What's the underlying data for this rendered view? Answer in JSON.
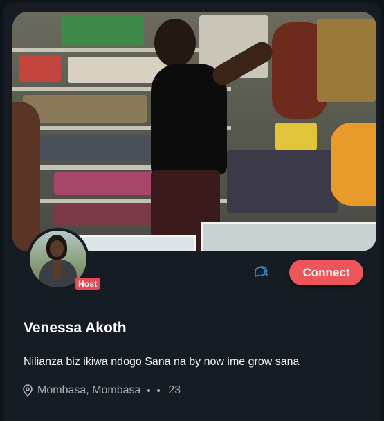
{
  "profile": {
    "name": "Venessa Akoth",
    "badge": "Host",
    "bio": "Nilianza biz ikiwa ndogo Sana na by now ime grow sana",
    "location": "Mombasa, Mombasa",
    "count": "23"
  },
  "actions": {
    "connect_label": "Connect",
    "chat_icon": "chat-bubbles-icon"
  },
  "colors": {
    "accent": "#ec5559",
    "badge": "#e84a55",
    "card_bg": "#161c23",
    "page_bg": "#0f141a"
  }
}
